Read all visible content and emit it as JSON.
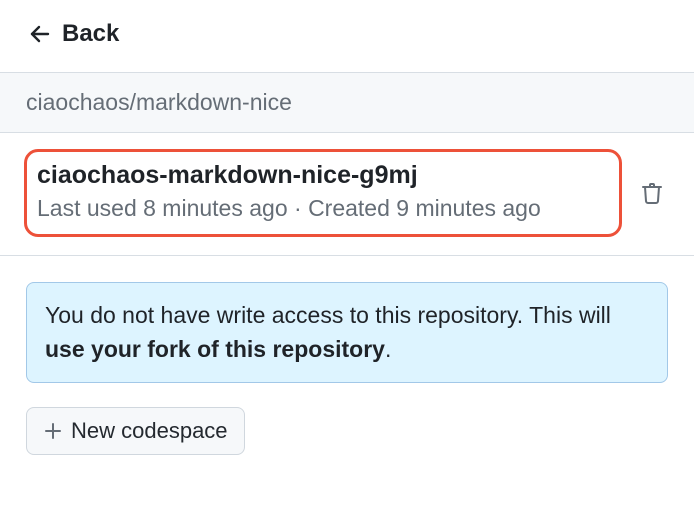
{
  "header": {
    "back_label": "Back"
  },
  "repo": {
    "path": "ciaochaos/markdown-nice"
  },
  "codespace": {
    "name": "ciaochaos-markdown-nice-g9mj",
    "last_used": "Last used 8 minutes ago",
    "separator": " · ",
    "created": "Created 9 minutes ago"
  },
  "flash": {
    "part1": "You do not have write access to this repository. This will ",
    "bold": "use your fork of this repository",
    "part2": "."
  },
  "actions": {
    "new_codespace_label": "New codespace"
  }
}
